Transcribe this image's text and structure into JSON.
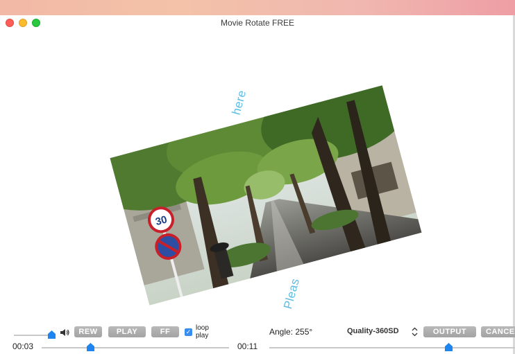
{
  "window": {
    "title": "Movie Rotate FREE"
  },
  "preview": {
    "overlay_top": "here",
    "overlay_bottom": "Pleas",
    "sign_speed": "30"
  },
  "controls": {
    "rew_label": "REW",
    "play_label": "PLAY",
    "ff_label": "FF",
    "loop_label_line1": "loop",
    "loop_label_line2": "play",
    "loop_checked": true,
    "angle_text": "Angle: 255°",
    "quality_text": "Quality-360SD",
    "output_label": "OUTPUT",
    "cancel_label": "CANCE",
    "current_time": "00:03",
    "total_time": "00:11",
    "volume_level": 0.88,
    "position_fraction": 0.27
  }
}
